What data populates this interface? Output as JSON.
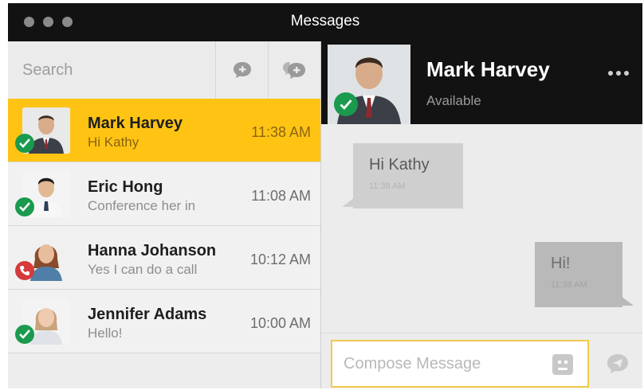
{
  "window": {
    "title": "Messages"
  },
  "sidebar": {
    "search": {
      "placeholder": "Search"
    },
    "buttons": {
      "new_message_icon": "chat-plus-icon",
      "new_group_icon": "group-chat-plus-icon"
    },
    "conversations": [
      {
        "name": "Mark Harvey",
        "preview": "Hi Kathy",
        "time": "11:38 AM",
        "status": "available",
        "active": true
      },
      {
        "name": "Eric Hong",
        "preview": "Conference her in",
        "time": "11:08 AM",
        "status": "available",
        "active": false
      },
      {
        "name": "Hanna Johanson",
        "preview": "Yes I can do a call",
        "time": "10:12 AM",
        "status": "on-call",
        "active": false
      },
      {
        "name": "Jennifer Adams",
        "preview": "Hello!",
        "time": "10:00 AM",
        "status": "available",
        "active": false
      }
    ]
  },
  "chat": {
    "contact": {
      "name": "Mark Harvey",
      "presence": "Available"
    },
    "more_icon": "more-horizontal-icon",
    "messages": [
      {
        "direction": "incoming",
        "text": "Hi Kathy",
        "time": "11:38 AM"
      },
      {
        "direction": "outgoing",
        "text": "Hi!",
        "time": "11:38 AM"
      }
    ],
    "composer": {
      "placeholder": "Compose Message",
      "emoji_icon": "emoji-icon",
      "send_icon": "send-icon"
    }
  },
  "colors": {
    "accent": "#ffc413",
    "available": "#1a9a4e",
    "on_call": "#d63a3a",
    "header": "#121212"
  }
}
